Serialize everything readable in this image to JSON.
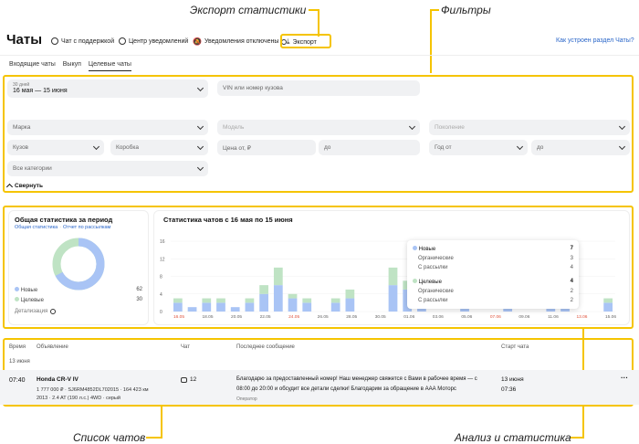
{
  "callouts": {
    "export": "Экспорт статистики",
    "filters": "Фильтры",
    "chat_list": "Список чатов",
    "analytics": "Анализ и статистика"
  },
  "topbar": {
    "title": "Чаты",
    "support": "Чат с поддержкой",
    "notify_center": "Центр уведомлений",
    "notify_off": "Уведомления отключены",
    "export": "Экспорт",
    "help_link": "Как устроен раздел Чаты?"
  },
  "tabs": [
    "Входящие чаты",
    "Выкуп",
    "Целевые чаты"
  ],
  "filters": {
    "period_label": "30 дней",
    "period_value": "16 мая — 15 июня",
    "vin": "VIN или номер кузова",
    "brand": "Марка",
    "model": "Модель",
    "generation": "Поколение",
    "body": "Кузов",
    "gearbox": "Коробка",
    "price_from": "Цена от, ₽",
    "price_to": "до",
    "year_from": "Год от",
    "year_to": "до",
    "category": "Все категории",
    "collapse": "Свернуть"
  },
  "summary": {
    "title": "Общая статистика за период",
    "link1": "Общая статистика",
    "sep": "·",
    "link2": "Отчет по рассылкам",
    "new_label": "Новые",
    "new_value": "62",
    "target_label": "Целевые",
    "target_value": "30",
    "detail": "Детализация"
  },
  "chart_data": {
    "type": "bar",
    "title": "Статистика чатов с 16 мая по 15 июня",
    "y_ticks": [
      "16",
      "12",
      "8",
      "4",
      "0"
    ],
    "ylim": [
      0,
      16
    ],
    "x_tick_labels": [
      "16.05",
      "18.05",
      "20.05",
      "22.05",
      "24.05",
      "26.05",
      "28.05",
      "30.05",
      "01.06",
      "03.06",
      "05.06",
      "07.06",
      "09.06",
      "11.06",
      "13.06",
      "15.06"
    ],
    "series": [
      {
        "name": "Новые",
        "values": [
          2,
          1,
          2,
          2,
          1,
          2,
          4,
          6,
          3,
          2,
          0,
          2,
          3,
          0,
          0,
          6,
          5,
          7,
          0,
          0,
          3,
          0,
          0,
          1,
          0,
          0,
          1,
          2,
          0,
          0,
          2
        ]
      },
      {
        "name": "Целевые",
        "values": [
          1,
          0,
          1,
          1,
          0,
          1,
          2,
          4,
          1,
          1,
          0,
          1,
          2,
          0,
          0,
          4,
          2,
          4,
          0,
          0,
          2,
          0,
          0,
          0,
          0,
          0,
          0,
          1,
          0,
          0,
          1
        ]
      }
    ]
  },
  "tooltip": {
    "new_label": "Новые",
    "new_value": "7",
    "organic1": "Органические",
    "organic1_value": "3",
    "mailing1": "С рассылки",
    "mailing1_value": "4",
    "target_label": "Целевые",
    "target_value": "4",
    "organic2": "Органические",
    "organic2_value": "2",
    "mailing2": "С рассылки",
    "mailing2_value": "2"
  },
  "table": {
    "headers": {
      "time": "Время",
      "ad": "Объявление",
      "chat": "Чат",
      "last": "Последнее сообщение",
      "start": "Старт чата"
    },
    "date_group": "13 июня",
    "row": {
      "time": "07:40",
      "car": "Honda CR-V IV",
      "line1": "1 777 000 ₽ · SJ6RM4852DL702015 · 164 423 км",
      "line2": "2013 · 2.4 AT (190 л.с.) 4WD · серый",
      "chat_count": "12",
      "msg1": "Благодарю за предоставленный номер! Наш менеджер свяжется с Вами в рабочее время — с",
      "msg2": "08:00 до 20:00 и обсудит все детали сделки! Благодарим за обращение в ААА Моторс",
      "author": "Оператор",
      "start_date": "13 июня",
      "start_time": "07:36",
      "more": "···"
    }
  },
  "colors": {
    "accent": "#f5c400",
    "new": "#a9c4f5",
    "target": "#bfe3c4",
    "link": "#2a66c9"
  }
}
